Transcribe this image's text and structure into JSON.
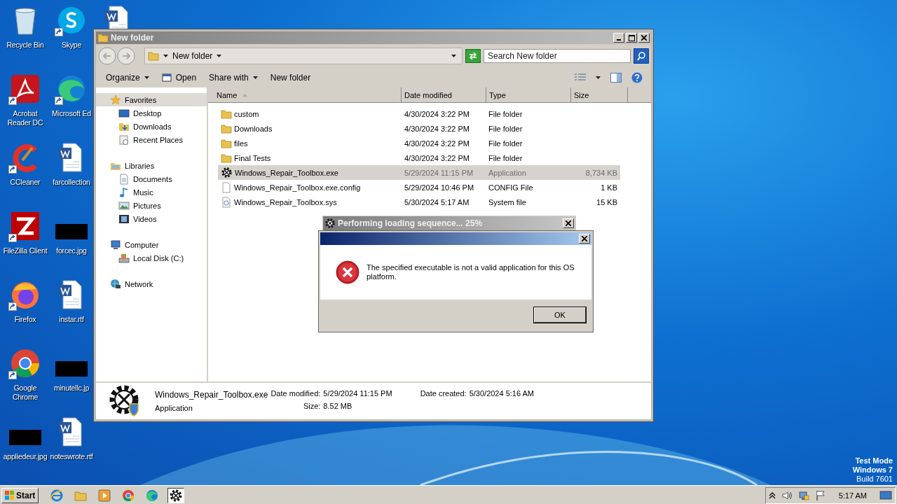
{
  "desktop_icons": [
    {
      "kind": "recycle",
      "shortcut": false,
      "label_lines": [
        "Recycle Bin"
      ]
    },
    {
      "kind": "acrobat",
      "shortcut": true,
      "label_lines": [
        "Acrobat",
        "Reader DC"
      ]
    },
    {
      "kind": "ccleaner",
      "shortcut": true,
      "label_lines": [
        "CCleaner"
      ]
    },
    {
      "kind": "filezilla",
      "shortcut": true,
      "label_lines": [
        "FileZilla Client"
      ]
    },
    {
      "kind": "firefox",
      "shortcut": true,
      "label_lines": [
        "Firefox"
      ]
    },
    {
      "kind": "chrome",
      "shortcut": true,
      "label_lines": [
        "Google",
        "Chrome"
      ]
    },
    {
      "kind": "image",
      "shortcut": false,
      "label_lines": [
        "appliedeur.jpg"
      ]
    },
    {
      "kind": "skype",
      "shortcut": true,
      "label_lines": [
        "Skype"
      ]
    },
    {
      "kind": "edge",
      "shortcut": true,
      "label_lines": [
        "Microsoft Ed"
      ]
    },
    {
      "kind": "document",
      "shortcut": false,
      "label_lines": [
        "farcollection"
      ]
    },
    {
      "kind": "image",
      "shortcut": false,
      "label_lines": [
        "forcec.jpg"
      ]
    },
    {
      "kind": "document",
      "shortcut": false,
      "label_lines": [
        "instar.rtf"
      ]
    },
    {
      "kind": "image",
      "shortcut": false,
      "label_lines": [
        "minutellc.jp"
      ]
    },
    {
      "kind": "document",
      "shortcut": false,
      "label_lines": [
        "noteswrote.rtf"
      ]
    },
    {
      "kind": "document",
      "shortcut": false
    }
  ],
  "explorer": {
    "title": "New folder",
    "address": "New folder",
    "search": {
      "placeholder": "Search New folder"
    },
    "toolbar": [
      {
        "kind": "menu",
        "label": "Organize"
      },
      {
        "kind": "open",
        "label": "Open"
      },
      {
        "kind": "menu",
        "label": "Share with"
      },
      {
        "kind": "plain",
        "label": "New folder"
      }
    ],
    "nav": [
      {
        "kind": "favorites",
        "label": "Favorites",
        "selected": true,
        "children": [
          {
            "kind": "desktop",
            "label": "Desktop",
            "selected": false
          },
          {
            "kind": "downloads",
            "label": "Downloads",
            "selected": false
          },
          {
            "kind": "recent",
            "label": "Recent Places",
            "selected": false
          }
        ]
      },
      {
        "kind": "libraries",
        "label": "Libraries",
        "selected": false,
        "children": [
          {
            "kind": "documents",
            "label": "Documents",
            "selected": false
          },
          {
            "kind": "music",
            "label": "Music",
            "selected": false
          },
          {
            "kind": "pictures",
            "label": "Pictures",
            "selected": false
          },
          {
            "kind": "videos",
            "label": "Videos",
            "selected": false
          }
        ]
      },
      {
        "kind": "computer",
        "label": "Computer",
        "selected": false,
        "children": [
          {
            "kind": "disk",
            "label": "Local Disk (C:)",
            "selected": false
          }
        ]
      },
      {
        "kind": "network",
        "label": "Network",
        "selected": false
      }
    ],
    "columns": [
      {
        "label": "Name",
        "sorted": true
      },
      {
        "label": "Date modified",
        "sorted": false
      },
      {
        "label": "Type",
        "sorted": false
      },
      {
        "label": "Size",
        "sorted": false
      }
    ],
    "files": [
      {
        "kind": "folder",
        "name": "custom",
        "date": "4/30/2024 3:22 PM",
        "type": "File folder",
        "selected": false
      },
      {
        "kind": "folder",
        "name": "Downloads",
        "date": "4/30/2024 3:22 PM",
        "type": "File folder",
        "selected": false
      },
      {
        "kind": "folder",
        "name": "files",
        "date": "4/30/2024 3:22 PM",
        "type": "File folder",
        "selected": false
      },
      {
        "kind": "folder",
        "name": "Final Tests",
        "date": "4/30/2024 3:22 PM",
        "type": "File folder",
        "selected": false
      },
      {
        "kind": "exe",
        "name": "Windows_Repair_Toolbox.exe",
        "date": "5/29/2024 11:15 PM",
        "type": "Application",
        "size": "8,734 KB",
        "selected": true
      },
      {
        "kind": "config",
        "name": "Windows_Repair_Toolbox.exe.config",
        "date": "5/29/2024 10:46 PM",
        "type": "CONFIG File",
        "size": "1 KB",
        "selected": false
      },
      {
        "kind": "sys",
        "name": "Windows_Repair_Toolbox.sys",
        "date": "5/30/2024 5:17 AM",
        "type": "System file",
        "size": "15 KB",
        "selected": false
      }
    ],
    "details": {
      "name": "Windows_Repair_Toolbox.exe",
      "type": "Application",
      "date_modified_label": "Date modified:",
      "date_modified": "5/29/2024 11:15 PM",
      "size_label": "Size:",
      "size": "8.52 MB",
      "date_created_label": "Date created:",
      "date_created": "5/30/2024 5:16 AM"
    }
  },
  "loading_dialog": {
    "title": "Performing loading sequence... 25%"
  },
  "error_dialog": {
    "message": "The specified executable is not a valid application for this OS platform.",
    "button": "OK"
  },
  "test_mode_notice": [
    "Test Mode",
    "Windows 7",
    "Build 7601"
  ],
  "taskbar": {
    "start": "Start",
    "pinned": [
      {
        "kind": "ie",
        "selected": false
      },
      {
        "kind": "explorer",
        "selected": false
      },
      {
        "kind": "media",
        "selected": false
      },
      {
        "kind": "chrome",
        "selected": false
      },
      {
        "kind": "edge",
        "selected": false
      },
      {
        "kind": "toolbox",
        "selected": true
      }
    ],
    "tray": [
      {
        "kind": "chevron"
      },
      {
        "kind": "speaker"
      },
      {
        "kind": "network"
      },
      {
        "kind": "flag"
      }
    ],
    "clock": "5:17 AM"
  }
}
